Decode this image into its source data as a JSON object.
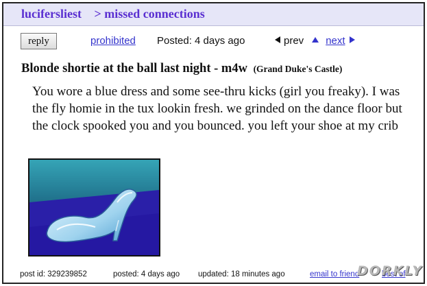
{
  "header": {
    "site": "lucifersliest",
    "separator": ">",
    "section": "missed connections"
  },
  "topbar": {
    "reply_label": "reply",
    "prohibited_label": "prohibited",
    "posted": "Posted: 4 days ago",
    "prev_label": "prev",
    "next_label": "next"
  },
  "post": {
    "title": "Blonde shortie at the ball last night - m4w",
    "location": "(Grand Duke's Castle)",
    "body": "You wore a blue dress and some see-thru kicks (girl you freaky). I was the fly homie in the tux lookin fresh. we grinded on the dance floor but the clock spooked you and you bounced. you left your shoe at my crib",
    "image_icon": "glass-slipper-icon"
  },
  "footer": {
    "post_id": "post id: 329239852",
    "posted": "posted: 4 days ago",
    "updated": "updated: 18 minutes ago",
    "email_label": "email to friend",
    "best_of_label": "best of"
  },
  "watermark": "DORKLY",
  "colors": {
    "link": "#3333cc",
    "header_text": "#5a2fd1",
    "header_bg": "#e6e6f8"
  }
}
